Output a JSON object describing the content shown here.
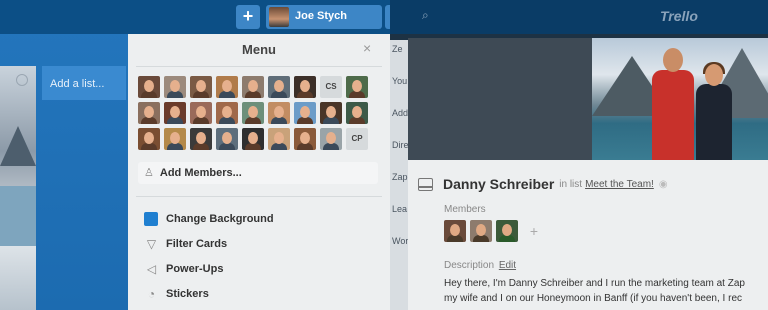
{
  "topbar": {
    "add_label": "+",
    "user_name": "Joe Stych",
    "bell_icon": "bell-icon",
    "search_icon": "search-icon",
    "logo_text": "Trello"
  },
  "board": {
    "add_list_label": "Add a list..."
  },
  "menu": {
    "title": "Menu",
    "close_label": "×",
    "members_rows": [
      [
        "#6a4a3a",
        "#9c8a7c",
        "#7a5a44",
        "#b07b4a",
        "#8d7b6d",
        "#5f6d78",
        "#3c2f28",
        "CS",
        "#4e6b4a"
      ],
      [
        "#8a6f5e",
        "#6b3b2a",
        "#9a6a5a",
        "#a0694a",
        "#6d8f7a",
        "#c28d63",
        "#6c9cc8",
        "#4a3528",
        "#3d5a48"
      ],
      [
        "#7a4e32",
        "#b48a4a",
        "#3a3a3a",
        "#5d6e7c",
        "#2f2f2f",
        "#c9a27a",
        "#8a5a3a",
        "#9aa4a8",
        "CP"
      ]
    ],
    "add_members_icon": "person-icon",
    "add_members_label": "Add Members...",
    "items": [
      {
        "icon": "color-swatch-icon",
        "glyph": "",
        "label": "Change Background"
      },
      {
        "icon": "filter-icon",
        "glyph": "▽",
        "label": "Filter Cards"
      },
      {
        "icon": "power-ups-icon",
        "glyph": "◁",
        "label": "Power-Ups"
      },
      {
        "icon": "sticker-icon",
        "glyph": "◔",
        "label": "Stickers"
      }
    ]
  },
  "peek_list": [
    "Ze",
    "You",
    "Add",
    "Dire",
    "Zap",
    "Lea",
    "Wor"
  ],
  "card": {
    "title": "Danny Schreiber",
    "in_list_prefix": "in list",
    "list_name": "Meet the Team!",
    "members_label": "Members",
    "members": [
      "#6a4a3a",
      "#8d7b6d",
      "#3c5a3a"
    ],
    "add_member_label": "+",
    "description_label": "Description",
    "description_edit": "Edit",
    "description_line1": "Hey there, I'm Danny Schreiber and I run the marketing team at Zap",
    "description_line2": "my wife and I on our Honeymoon in Banff (if you haven't been, I rec"
  }
}
